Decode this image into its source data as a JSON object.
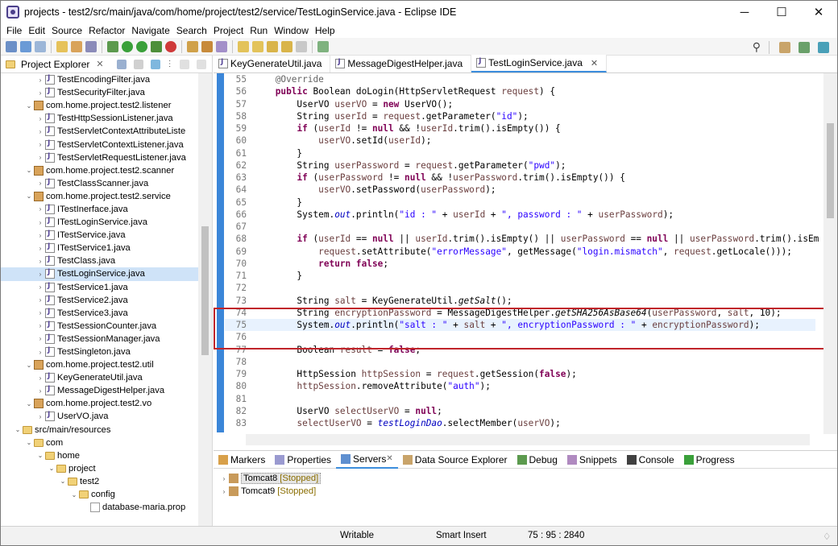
{
  "window": {
    "title": "projects - test2/src/main/java/com/home/project/test2/service/TestLoginService.java - Eclipse IDE",
    "min": "─",
    "max": "☐",
    "close": "✕"
  },
  "menu": [
    "File",
    "Edit",
    "Source",
    "Refactor",
    "Navigate",
    "Search",
    "Project",
    "Run",
    "Window",
    "Help"
  ],
  "explorer": {
    "tab_label": "Project Explorer",
    "items": [
      {
        "label": "TestEncodingFilter.java",
        "icon": "java-file-icon",
        "indent": 4,
        "twisty": "›"
      },
      {
        "label": "TestSecurityFilter.java",
        "icon": "java-file-icon",
        "indent": 4,
        "twisty": "›"
      },
      {
        "label": "com.home.project.test2.listener",
        "icon": "package-icon",
        "indent": 3,
        "twisty": "⌄"
      },
      {
        "label": "TestHttpSessionListener.java",
        "icon": "java-file-icon",
        "indent": 4,
        "twisty": "›"
      },
      {
        "label": "TestServletContextAttributeListe",
        "icon": "java-file-icon",
        "indent": 4,
        "twisty": "›"
      },
      {
        "label": "TestServletContextListener.java",
        "icon": "java-file-icon",
        "indent": 4,
        "twisty": "›"
      },
      {
        "label": "TestServletRequestListener.java",
        "icon": "java-file-icon",
        "indent": 4,
        "twisty": "›"
      },
      {
        "label": "com.home.project.test2.scanner",
        "icon": "package-icon",
        "indent": 3,
        "twisty": "⌄"
      },
      {
        "label": "TestClassScanner.java",
        "icon": "java-file-icon",
        "indent": 4,
        "twisty": "›"
      },
      {
        "label": "com.home.project.test2.service",
        "icon": "package-icon",
        "indent": 3,
        "twisty": "⌄"
      },
      {
        "label": "ITestInerface.java",
        "icon": "java-file-icon",
        "indent": 4,
        "twisty": "›"
      },
      {
        "label": "ITestLoginService.java",
        "icon": "java-file-icon",
        "indent": 4,
        "twisty": "›"
      },
      {
        "label": "ITestService.java",
        "icon": "java-file-icon",
        "indent": 4,
        "twisty": "›"
      },
      {
        "label": "ITestService1.java",
        "icon": "java-file-icon",
        "indent": 4,
        "twisty": "›"
      },
      {
        "label": "TestClass.java",
        "icon": "java-file-icon",
        "indent": 4,
        "twisty": "›"
      },
      {
        "label": "TestLoginService.java",
        "icon": "java-file-icon",
        "indent": 4,
        "twisty": "›",
        "selected": true
      },
      {
        "label": "TestService1.java",
        "icon": "java-file-icon",
        "indent": 4,
        "twisty": "›"
      },
      {
        "label": "TestService2.java",
        "icon": "java-file-icon",
        "indent": 4,
        "twisty": "›"
      },
      {
        "label": "TestService3.java",
        "icon": "java-file-icon",
        "indent": 4,
        "twisty": "›"
      },
      {
        "label": "TestSessionCounter.java",
        "icon": "java-file-icon",
        "indent": 4,
        "twisty": "›"
      },
      {
        "label": "TestSessionManager.java",
        "icon": "java-file-icon",
        "indent": 4,
        "twisty": "›"
      },
      {
        "label": "TestSingleton.java",
        "icon": "java-file-icon",
        "indent": 4,
        "twisty": "›"
      },
      {
        "label": "com.home.project.test2.util",
        "icon": "package-icon",
        "indent": 3,
        "twisty": "⌄"
      },
      {
        "label": "KeyGenerateUtil.java",
        "icon": "java-file-icon",
        "indent": 4,
        "twisty": "›"
      },
      {
        "label": "MessageDigestHelper.java",
        "icon": "java-file-icon",
        "indent": 4,
        "twisty": "›"
      },
      {
        "label": "com.home.project.test2.vo",
        "icon": "package-icon",
        "indent": 3,
        "twisty": "⌄"
      },
      {
        "label": "UserVO.java",
        "icon": "java-file-icon",
        "indent": 4,
        "twisty": "›"
      },
      {
        "label": "src/main/resources",
        "icon": "source-folder-icon",
        "indent": 2,
        "twisty": "⌄"
      },
      {
        "label": "com",
        "icon": "folder-icon",
        "indent": 3,
        "twisty": "⌄"
      },
      {
        "label": "home",
        "icon": "folder-icon",
        "indent": 4,
        "twisty": "⌄"
      },
      {
        "label": "project",
        "icon": "folder-icon",
        "indent": 5,
        "twisty": "⌄"
      },
      {
        "label": "test2",
        "icon": "folder-icon",
        "indent": 6,
        "twisty": "⌄"
      },
      {
        "label": "config",
        "icon": "folder-icon",
        "indent": 7,
        "twisty": "⌄"
      },
      {
        "label": "database-maria.prop",
        "icon": "properties-file-icon",
        "indent": 8,
        "twisty": ""
      }
    ]
  },
  "editor": {
    "tabs": [
      {
        "label": "KeyGenerateUtil.java",
        "active": false
      },
      {
        "label": "MessageDigestHelper.java",
        "active": false
      },
      {
        "label": "TestLoginService.java",
        "active": true
      }
    ],
    "lines": [
      {
        "n": "55",
        "html": "    <span class=\"ann\">@Override</span>"
      },
      {
        "n": "56",
        "html": "    <span class=\"kw\">public</span> Boolean doLogin(HttpServletRequest <span class=\"var\">request</span>) {"
      },
      {
        "n": "57",
        "html": "        UserVO <span class=\"var\">userVO</span> = <span class=\"kw\">new</span> UserVO();"
      },
      {
        "n": "58",
        "html": "        String <span class=\"var\">userId</span> = <span class=\"var\">request</span>.getParameter(<span class=\"str\">\"id\"</span>);"
      },
      {
        "n": "59",
        "html": "        <span class=\"kw\">if</span> (<span class=\"var\">userId</span> != <span class=\"kw\">null</span> &amp;&amp; !<span class=\"var\">userId</span>.trim().isEmpty()) {"
      },
      {
        "n": "60",
        "html": "            <span class=\"var\">userVO</span>.setId(<span class=\"var\">userId</span>);"
      },
      {
        "n": "61",
        "html": "        }"
      },
      {
        "n": "62",
        "html": "        String <span class=\"var\">userPassword</span> = <span class=\"var\">request</span>.getParameter(<span class=\"str\">\"pwd\"</span>);"
      },
      {
        "n": "63",
        "html": "        <span class=\"kw\">if</span> (<span class=\"var\">userPassword</span> != <span class=\"kw\">null</span> &amp;&amp; !<span class=\"var\">userPassword</span>.trim().isEmpty()) {"
      },
      {
        "n": "64",
        "html": "            <span class=\"var\">userVO</span>.setPassword(<span class=\"var\">userPassword</span>);"
      },
      {
        "n": "65",
        "html": "        }"
      },
      {
        "n": "66",
        "html": "        System.<span class=\"fld\">out</span>.println(<span class=\"str\">\"id : \"</span> + <span class=\"var\">userId</span> + <span class=\"str\">\", password : \"</span> + <span class=\"var\">userPassword</span>);"
      },
      {
        "n": "67",
        "html": ""
      },
      {
        "n": "68",
        "html": "        <span class=\"kw\">if</span> (<span class=\"var\">userId</span> == <span class=\"kw\">null</span> || <span class=\"var\">userId</span>.trim().isEmpty() || <span class=\"var\">userPassword</span> == <span class=\"kw\">null</span> || <span class=\"var\">userPassword</span>.trim().isEm"
      },
      {
        "n": "69",
        "html": "            <span class=\"var\">request</span>.setAttribute(<span class=\"str\">\"errorMessage\"</span>, getMessage(<span class=\"str\">\"login.mismatch\"</span>, <span class=\"var\">request</span>.getLocale()));"
      },
      {
        "n": "70",
        "html": "            <span class=\"kw\">return</span> <span class=\"kw\">false</span>;"
      },
      {
        "n": "71",
        "html": "        }"
      },
      {
        "n": "72",
        "html": ""
      },
      {
        "n": "73",
        "html": "        String <span class=\"var\">salt</span> = KeyGenerateUtil.<span class=\"mtd\">getSalt</span>();"
      },
      {
        "n": "74",
        "html": "        String <span class=\"var\">encryptionPassword</span> = MessageDigestHelper.<span class=\"mtd\">getSHA256AsBase64</span>(<span class=\"var\">userPassword</span>, <span class=\"var\">salt</span>, 10);"
      },
      {
        "n": "75",
        "html": "        System.<span class=\"fld\">out</span>.println(<span class=\"str\">\"salt : \"</span> + <span class=\"var\">salt</span> + <span class=\"str\">\", encryptionPassword : \"</span> + <span class=\"var\">encryptionPassword</span>);",
        "current": true
      },
      {
        "n": "76",
        "html": ""
      },
      {
        "n": "77",
        "html": "        Boolean <span class=\"var\">result</span> = <span class=\"kw\">false</span>;"
      },
      {
        "n": "78",
        "html": ""
      },
      {
        "n": "79",
        "html": "        HttpSession <span class=\"var\">httpSession</span> = <span class=\"var\">request</span>.getSession(<span class=\"kw\">false</span>);"
      },
      {
        "n": "80",
        "html": "        <span class=\"var\">httpSession</span>.removeAttribute(<span class=\"str\">\"auth\"</span>);"
      },
      {
        "n": "81",
        "html": ""
      },
      {
        "n": "82",
        "html": "        UserVO <span class=\"var\">selectUserVO</span> = <span class=\"kw\">null</span>;"
      },
      {
        "n": "83",
        "html": "        <span class=\"var\">selectUserVO</span> = <span class=\"fld\">testLoginDao</span>.selectMember(<span class=\"var\">userVO</span>);"
      }
    ]
  },
  "bottom": {
    "tabs": [
      {
        "label": "Markers",
        "active": false
      },
      {
        "label": "Properties",
        "active": false
      },
      {
        "label": "Servers",
        "active": true
      },
      {
        "label": "Data Source Explorer",
        "active": false
      },
      {
        "label": "Debug",
        "active": false
      },
      {
        "label": "Snippets",
        "active": false
      },
      {
        "label": "Console",
        "active": false
      },
      {
        "label": "Progress",
        "active": false
      }
    ],
    "servers": [
      {
        "name": "Tomcat8",
        "status": "[Stopped]"
      },
      {
        "name": "Tomcat9",
        "status": "[Stopped]"
      }
    ]
  },
  "status": {
    "mode": "Writable",
    "insert": "Smart Insert",
    "position": "75 : 95 : 2840"
  },
  "colors": {
    "accent": "#3b86d8",
    "highlight_box": "#c0242a",
    "selection": "#cfe3f8"
  }
}
